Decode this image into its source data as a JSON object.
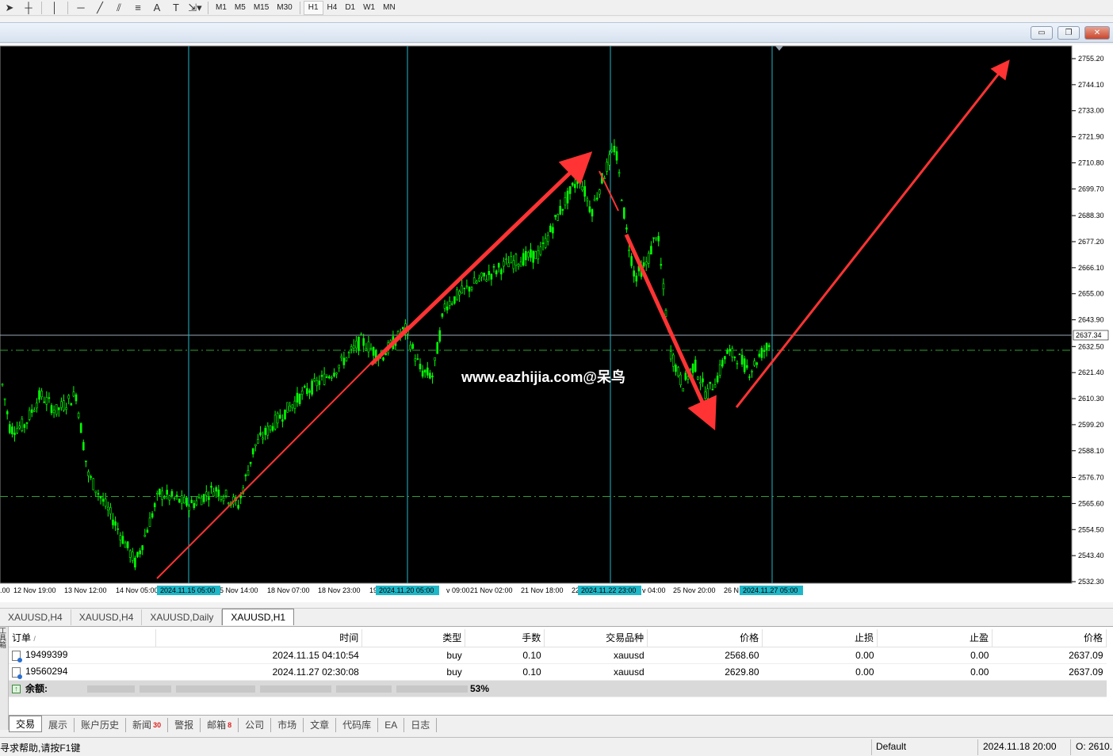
{
  "toolbar": {
    "tools": [
      "cursor-icon",
      "crosshair-icon",
      "vertical-line-icon",
      "horizontal-line-icon",
      "trendline-icon",
      "channel-icon",
      "fibonacci-icon",
      "text-icon",
      "label-icon",
      "arrows-icon"
    ],
    "text_tool": "A",
    "timeframes": [
      "M1",
      "M5",
      "M15",
      "M30",
      "H1",
      "H4",
      "D1",
      "W1",
      "MN"
    ],
    "active_timeframe": "H1"
  },
  "chart": {
    "background": "#000000",
    "bull_color": "#00ff00",
    "watermark": "www.eazhijia.com@呆鸟",
    "bid_label": "2637.34",
    "price_axis": [
      "2755.20",
      "2744.10",
      "2733.00",
      "2721.90",
      "2710.80",
      "2699.70",
      "2688.30",
      "2677.20",
      "2666.10",
      "2655.00",
      "2643.90",
      "2632.50",
      "2621.40",
      "2610.30",
      "2599.20",
      "2588.10",
      "2576.70",
      "2565.60",
      "2554.50",
      "2543.40",
      "2532.30"
    ],
    "time_axis": [
      ".00",
      "12 Nov 19:00",
      "13 Nov 12:00",
      "14 Nov 05:00",
      "5 Nov 14:00",
      "18 Nov 07:00",
      "18 Nov 23:00",
      "19",
      "v 09:00",
      "21 Nov 02:00",
      "21 Nov 18:00",
      "22",
      "v 04:00",
      "25 Nov 20:00",
      "26 N"
    ],
    "vline_labels": [
      "2024.11.15 05:00",
      "2024.11.20 05:00",
      "2024.11.22 23:00",
      "2024.11.27 05:00"
    ],
    "arrow_color": "#ff3333",
    "vline_color": "#1fb7c8",
    "dashed_line_color": "#2ea02e"
  },
  "chart_tabs": [
    "XAUUSD,H4",
    "XAUUSD,H4",
    "XAUUSD,Daily",
    "XAUUSD,H1"
  ],
  "active_chart_tab": 3,
  "terminal": {
    "side_label": "工具箱",
    "headers": [
      "订单",
      "/",
      "时间",
      "类型",
      "手数",
      "交易品种",
      "价格",
      "止损",
      "止盈",
      "价格"
    ],
    "rows": [
      {
        "order": "19499399",
        "time": "2024.11.15 04:10:54",
        "type": "buy",
        "lots": "0.10",
        "symbol": "xauusd",
        "price": "2568.60",
        "sl": "0.00",
        "tp": "0.00",
        "cur": "2637.09"
      },
      {
        "order": "19560294",
        "time": "2024.11.27 02:30:08",
        "type": "buy",
        "lots": "0.10",
        "symbol": "xauusd",
        "price": "2629.80",
        "sl": "0.00",
        "tp": "0.00",
        "cur": "2637.09"
      }
    ],
    "balance_label": "余额:",
    "balance_fragment": "53%"
  },
  "bottom_tabs": [
    {
      "label": "交易",
      "badge": ""
    },
    {
      "label": "展示",
      "badge": ""
    },
    {
      "label": "账户历史",
      "badge": ""
    },
    {
      "label": "新闻",
      "badge": "30"
    },
    {
      "label": "警报",
      "badge": ""
    },
    {
      "label": "邮箱",
      "badge": "8"
    },
    {
      "label": "公司",
      "badge": ""
    },
    {
      "label": "市场",
      "badge": ""
    },
    {
      "label": "文章",
      "badge": ""
    },
    {
      "label": "代码库",
      "badge": ""
    },
    {
      "label": "EA",
      "badge": ""
    },
    {
      "label": "日志",
      "badge": ""
    }
  ],
  "status_bar": {
    "help": "寻求帮助,请按F1键",
    "profile": "Default",
    "datetime": "2024.11.18 20:00",
    "open": "O: 2610."
  }
}
